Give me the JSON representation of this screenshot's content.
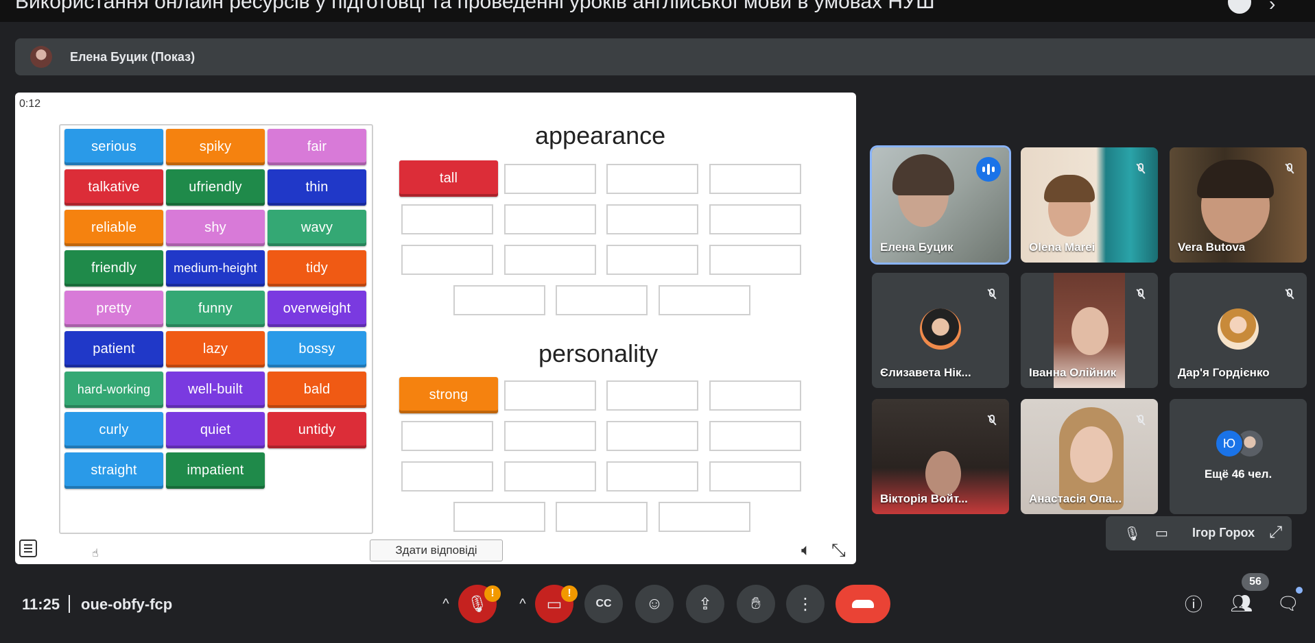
{
  "window": {
    "title": "Використання онлайн ресурсів у підготовці та проведенні уроків англійської мови в умовах НУШ"
  },
  "presenter_bar": {
    "name": "Елена Буцик (Показ)"
  },
  "activity": {
    "timer": "0:12",
    "word_bank": [
      {
        "label": "serious",
        "color": "#2a9ae8"
      },
      {
        "label": "spiky",
        "color": "#f5820f"
      },
      {
        "label": "fair",
        "color": "#d87ad8"
      },
      {
        "label": "talkative",
        "color": "#dc2d38"
      },
      {
        "label": "ufriendly",
        "color": "#1f8a4a"
      },
      {
        "label": "thin",
        "color": "#2038c8"
      },
      {
        "label": "reliable",
        "color": "#f5820f"
      },
      {
        "label": "shy",
        "color": "#d87ad8"
      },
      {
        "label": "wavy",
        "color": "#34a874"
      },
      {
        "label": "friendly",
        "color": "#1f8a4a"
      },
      {
        "label": "medium-height",
        "color": "#2038c8"
      },
      {
        "label": "tidy",
        "color": "#f05a14"
      },
      {
        "label": "pretty",
        "color": "#d87ad8"
      },
      {
        "label": "funny",
        "color": "#34a874"
      },
      {
        "label": "overweight",
        "color": "#7a3ae0"
      },
      {
        "label": "patient",
        "color": "#2038c8"
      },
      {
        "label": "lazy",
        "color": "#f05a14"
      },
      {
        "label": "bossy",
        "color": "#2a9ae8"
      },
      {
        "label": "hard-working",
        "color": "#34a874"
      },
      {
        "label": "well-built",
        "color": "#7a3ae0"
      },
      {
        "label": "bald",
        "color": "#f05a14"
      },
      {
        "label": "curly",
        "color": "#2a9ae8"
      },
      {
        "label": "quiet",
        "color": "#7a3ae0"
      },
      {
        "label": "untidy",
        "color": "#dc2d38"
      },
      {
        "label": "straight",
        "color": "#2a9ae8"
      },
      {
        "label": "impatient",
        "color": "#1f8a4a"
      }
    ],
    "group_appearance": {
      "title": "appearance",
      "placed": [
        {
          "label": "tall",
          "color": "#dc2d38"
        }
      ]
    },
    "group_personality": {
      "title": "personality",
      "placed": [
        {
          "label": "strong",
          "color": "#f5820f"
        }
      ]
    },
    "submit_label": "Здати відповіді"
  },
  "participants": [
    {
      "name": "Елена Буцик",
      "speaking": true
    },
    {
      "name": "Olena Marei",
      "speaking": false
    },
    {
      "name": "Vera Butova",
      "speaking": false
    },
    {
      "name": "Єлизавета Нік...",
      "speaking": false
    },
    {
      "name": "Іванна Олійник",
      "speaking": false
    },
    {
      "name": "Дар'я Гордієнко",
      "speaking": false
    },
    {
      "name": "Вікторія Войт...",
      "speaking": false
    },
    {
      "name": "Анастасія Опа...",
      "speaking": false
    }
  ],
  "more_participants": {
    "label": "Ещё 46 чел.",
    "avatar_letter": "Ю"
  },
  "self_view": {
    "name": "Ігор Горох"
  },
  "bottom_bar": {
    "time": "11:25",
    "meeting_code": "oue-obfy-fcp",
    "people_count": "56",
    "alert_badge": "!",
    "icons": [
      "mic-off-icon",
      "camera-off-icon",
      "captions-icon",
      "emoji-icon",
      "present-icon",
      "raise-hand-icon",
      "more-icon",
      "leave-call-icon",
      "info-icon",
      "people-icon",
      "chat-icon"
    ]
  },
  "colors": {
    "speaking_blue": "#1a73e8",
    "leave_red": "#ea4335",
    "warning": "#f29900"
  }
}
